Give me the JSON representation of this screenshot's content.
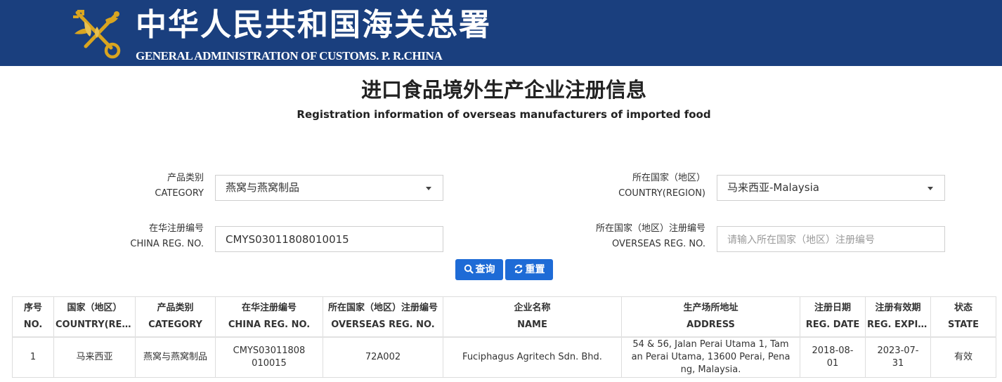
{
  "header": {
    "title_cn": "中华人民共和国海关总署",
    "title_en": "GENERAL ADMINISTRATION OF CUSTOMS. P. R.CHINA",
    "emblem_icon": "customs-emblem-icon",
    "background_color": "#1a3f7e"
  },
  "page": {
    "title_cn": "进口食品境外生产企业注册信息",
    "title_en": "Registration information of overseas manufacturers of imported food"
  },
  "form": {
    "category": {
      "label_cn": "产品类别",
      "label_en": "CATEGORY",
      "value": "燕窝与燕窝制品"
    },
    "country": {
      "label_cn": "所在国家（地区）",
      "label_en": "COUNTRY(REGION)",
      "value": "马来西亚-Malaysia"
    },
    "china_reg": {
      "label_cn": "在华注册编号",
      "label_en": "CHINA REG. NO.",
      "value": "CMYS03011808010015"
    },
    "overseas_reg": {
      "label_cn": "所在国家（地区）注册编号",
      "label_en": "OVERSEAS REG. NO.",
      "value": "",
      "placeholder": "请输入所在国家（地区）注册编号"
    },
    "search_label": "查询",
    "reset_label": "重置",
    "button_color": "#1e6bd6"
  },
  "table": {
    "headers": [
      {
        "cn": "序号",
        "en": "NO."
      },
      {
        "cn": "国家（地区）",
        "en": "COUNTRY(REGI…"
      },
      {
        "cn": "产品类别",
        "en": "CATEGORY"
      },
      {
        "cn": "在华注册编号",
        "en": "CHINA REG. NO."
      },
      {
        "cn": "所在国家（地区）注册编号",
        "en": "OVERSEAS REG. NO."
      },
      {
        "cn": "企业名称",
        "en": "NAME"
      },
      {
        "cn": "生产场所地址",
        "en": "ADDRESS"
      },
      {
        "cn": "注册日期",
        "en": "REG. DATE"
      },
      {
        "cn": "注册有效期",
        "en": "REG. EXPIR…"
      },
      {
        "cn": "状态",
        "en": "STATE"
      }
    ],
    "rows": [
      {
        "no": "1",
        "country": "马来西亚",
        "category": "燕窝与燕窝制品",
        "china_reg": "CMYS03011808010015",
        "overseas_reg": "72A002",
        "name": "Fuciphagus Agritech Sdn. Bhd.",
        "address": "54 & 56, Jalan Perai Utama 1, Taman Perai Utama, 13600 Perai, Penang, Malaysia.",
        "reg_date": "2018-08-01",
        "reg_expiry": "2023-07-31",
        "state": "有效"
      }
    ]
  }
}
